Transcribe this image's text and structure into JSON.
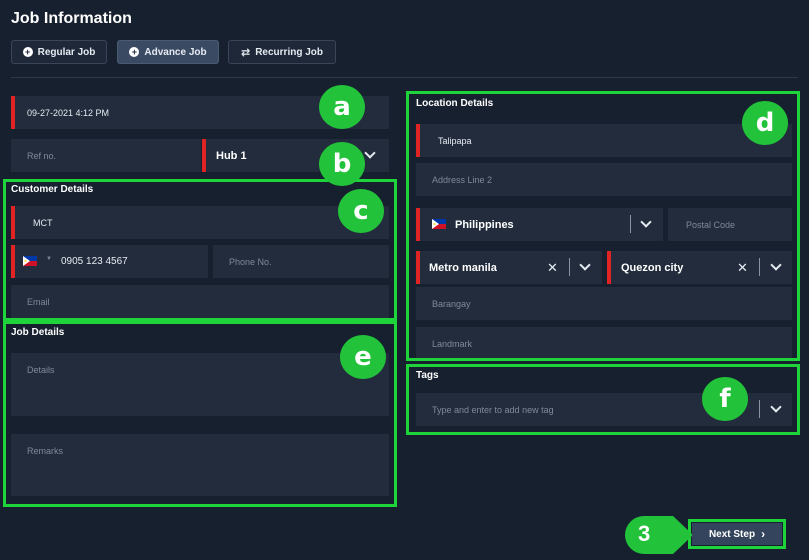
{
  "header": {
    "title": "Job Information"
  },
  "job_types": [
    {
      "label": "Regular Job",
      "icon": "plus-circle-icon"
    },
    {
      "label": "Advance Job",
      "icon": "plus-circle-icon"
    },
    {
      "label": "Recurring Job",
      "icon": "repeat-icon"
    }
  ],
  "left": {
    "datetime": "09-27-2021 4:12 PM",
    "ref_placeholder": "Ref no.",
    "hub_value": "Hub 1",
    "customer_title": "Customer Details",
    "customer_name": "MCT",
    "phone_value": "0905 123 4567",
    "phone_placeholder": "Phone No.",
    "email_placeholder": "Email",
    "job_title": "Job Details",
    "details_placeholder": "Details",
    "remarks_placeholder": "Remarks"
  },
  "right": {
    "location_title": "Location Details",
    "address_line1": "Talipapa",
    "address_line2_placeholder": "Address Line 2",
    "country": "Philippines",
    "postal_placeholder": "Postal Code",
    "province": "Metro manila",
    "city": "Quezon city",
    "barangay_placeholder": "Barangay",
    "landmark_placeholder": "Landmark",
    "tags_title": "Tags",
    "tags_placeholder": "Type and enter to add new tag"
  },
  "annotations": [
    "a",
    "b",
    "c",
    "d",
    "e",
    "f",
    "3"
  ],
  "footer": {
    "next_label": "Next Step"
  },
  "colors": {
    "accent_green": "#1fd33b",
    "required_red": "#e02424",
    "background": "#17202f"
  }
}
